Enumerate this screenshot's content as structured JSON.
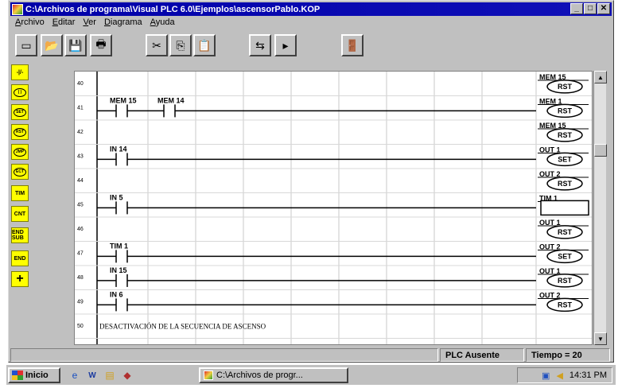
{
  "window": {
    "title": "C:\\Archivos de programa\\Visual PLC 6.0\\Ejemplos\\ascensorPablo.KOP",
    "buttons": [
      "_",
      "□",
      "✕"
    ]
  },
  "menu": [
    "Archivo",
    "Editar",
    "Ver",
    "Diagrama",
    "Ayuda"
  ],
  "toolbar": [
    {
      "icon": "new-file-icon",
      "glyph": "▭"
    },
    {
      "icon": "open-folder-icon",
      "glyph": "📂"
    },
    {
      "icon": "save-icon",
      "glyph": "💾"
    },
    {
      "icon": "print-icon",
      "glyph": "🖶"
    },
    {
      "icon": "cut-icon",
      "glyph": "✂"
    },
    {
      "icon": "copy-icon",
      "glyph": "⎘"
    },
    {
      "icon": "paste-icon",
      "glyph": "📋"
    },
    {
      "icon": "simulate-icon",
      "glyph": "⇆"
    },
    {
      "icon": "run-icon",
      "glyph": "▸"
    },
    {
      "icon": "exit-icon",
      "glyph": "🚪"
    }
  ],
  "palette": [
    {
      "icon": "contact-icon",
      "label": "-|/-"
    },
    {
      "icon": "coil-icon",
      "label": "( )"
    },
    {
      "icon": "set-coil-icon",
      "label": "SET"
    },
    {
      "icon": "reset-coil-icon",
      "label": "RST"
    },
    {
      "icon": "jump-coil-icon",
      "label": "JMP"
    },
    {
      "icon": "end-coil-icon",
      "label": "ECT"
    },
    {
      "icon": "timer-icon",
      "label": "TIM"
    },
    {
      "icon": "counter-icon",
      "label": "CNT"
    },
    {
      "icon": "end-sub-icon",
      "label": "END SUB"
    },
    {
      "icon": "end-icon",
      "label": "END"
    },
    {
      "icon": "cross-icon",
      "label": "+"
    }
  ],
  "rungs": [
    {
      "num": "40",
      "contacts": [],
      "coil_label": "MEM 15",
      "coil_type": "RST"
    },
    {
      "num": "41",
      "contacts": [
        {
          "label": "MEM 15"
        },
        {
          "label": "MEM 14"
        }
      ],
      "coil_label": "MEM 1",
      "coil_type": "RST"
    },
    {
      "num": "42",
      "contacts": [],
      "coil_label": "MEM 15",
      "coil_type": "RST"
    },
    {
      "num": "43",
      "contacts": [
        {
          "label": "IN 14"
        }
      ],
      "coil_label": "OUT 1",
      "coil_type": "SET"
    },
    {
      "num": "44",
      "contacts": [],
      "coil_label": "OUT 2",
      "coil_type": "RST"
    },
    {
      "num": "45",
      "contacts": [
        {
          "label": "IN 5"
        }
      ],
      "coil_label": "TIM 1",
      "coil_type": ""
    },
    {
      "num": "46",
      "contacts": [],
      "coil_label": "OUT 1",
      "coil_type": "RST"
    },
    {
      "num": "47",
      "contacts": [
        {
          "label": "TIM 1"
        }
      ],
      "coil_label": "OUT 2",
      "coil_type": "SET"
    },
    {
      "num": "48",
      "contacts": [
        {
          "label": "IN 15"
        }
      ],
      "coil_label": "OUT 1",
      "coil_type": "RST"
    },
    {
      "num": "49",
      "contacts": [
        {
          "label": "IN 6"
        }
      ],
      "coil_label": "OUT 2",
      "coil_type": "RST"
    },
    {
      "num": "50",
      "contacts": [],
      "coil_label": "",
      "coil_type": "",
      "comment": "DESACTIVACIÓN DE LA SECUENCIA DE ASCENSO"
    }
  ],
  "status": {
    "plc": "PLC Ausente",
    "tiempo": "Tiempo = 20"
  },
  "taskbar": {
    "start_label": "Inicio",
    "task_label": "C:\\Archivos de progr...",
    "clock": "14:31 PM",
    "quick_icons": [
      "internet-explorer-icon",
      "word-icon",
      "explorer-icon",
      "app-icon"
    ]
  }
}
